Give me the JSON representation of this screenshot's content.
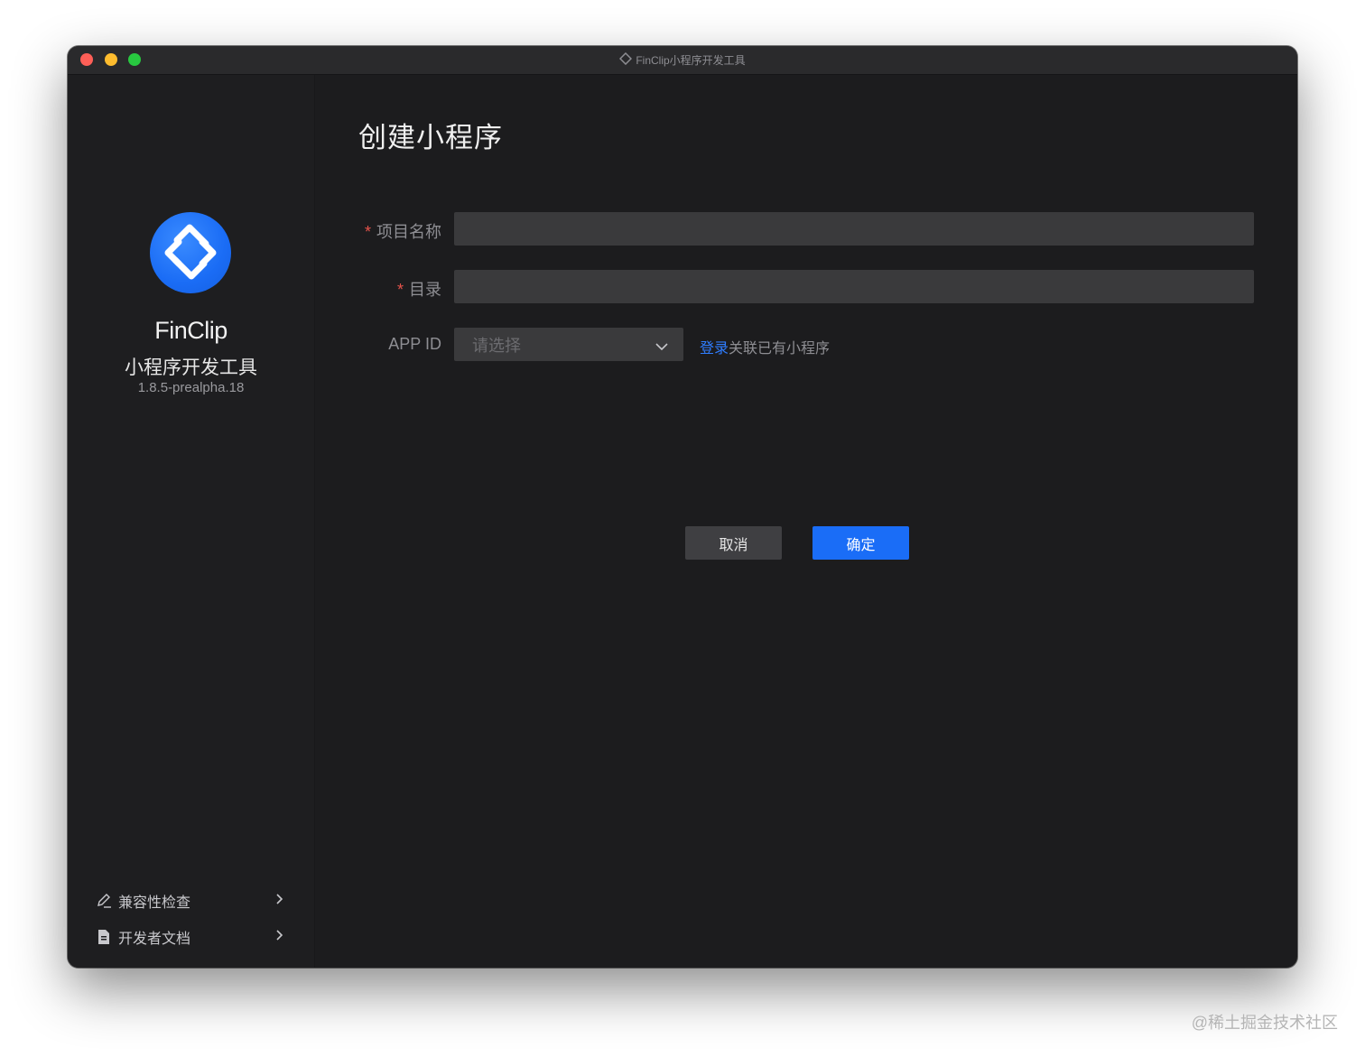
{
  "window": {
    "title": "FinClip小程序开发工具",
    "icons": {
      "title": "finclip-logo-icon"
    }
  },
  "sidebar": {
    "brand": "FinClip",
    "subtitle": "小程序开发工具",
    "version": "1.8.5-prealpha.18",
    "items": [
      {
        "label": "兼容性检查",
        "icon": "pen-icon"
      },
      {
        "label": "开发者文档",
        "icon": "document-icon"
      }
    ]
  },
  "main": {
    "title": "创建小程序",
    "form": {
      "required_mark": "*",
      "project_name_label": "项目名称",
      "project_name_value": "",
      "directory_label": "目录",
      "directory_value": "",
      "appid_label": "APP ID",
      "appid_placeholder": "请选择",
      "login_link": "登录",
      "login_suffix": "关联已有小程序"
    },
    "buttons": {
      "cancel": "取消",
      "ok": "确定"
    }
  },
  "watermark": "@稀土掘金技术社区",
  "colors": {
    "accent": "#1a6df7",
    "link": "#2f7dff",
    "required": "#e5534b",
    "background": "#1c1c1e"
  }
}
